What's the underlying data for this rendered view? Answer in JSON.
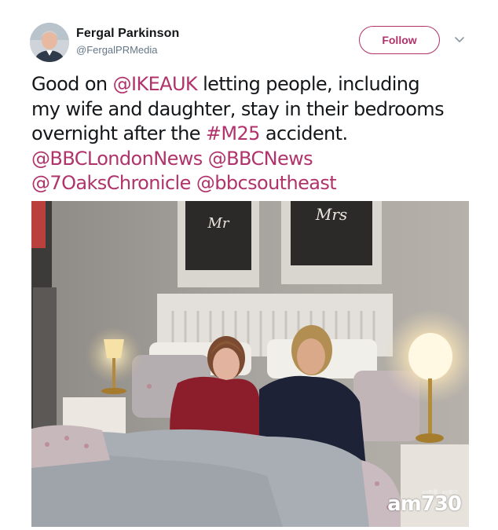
{
  "header": {
    "display_name": "Fergal Parkinson",
    "handle": "@FergalPRMedia",
    "follow_label": "Follow",
    "avatar_icon": "user-avatar-photo",
    "menu_icon": "chevron-down-icon"
  },
  "tweet": {
    "line1_text_a": "Good on ",
    "line1_link": "@IKEAUK",
    "line1_text_b": " letting people, including",
    "line2_text": "my wife and daughter, stay in their bedrooms",
    "line3_text_a": "overnight after the ",
    "line3_link": "#M25",
    "line3_text_b": " accident.",
    "line4_link_a": "@BBCLondonNews",
    "line4_link_b": "@BBCNews",
    "line5_link_a": "@7OaksChronicle",
    "line5_link_b": "@bbcsoutheast"
  },
  "photo": {
    "sign_left": "Mr",
    "sign_right": "Mrs",
    "watermark_small": "am新聞 · am紫印",
    "watermark_main": "am730"
  },
  "colors": {
    "link": "#b0336b",
    "text": "#14171a",
    "secondary": "#657786"
  }
}
